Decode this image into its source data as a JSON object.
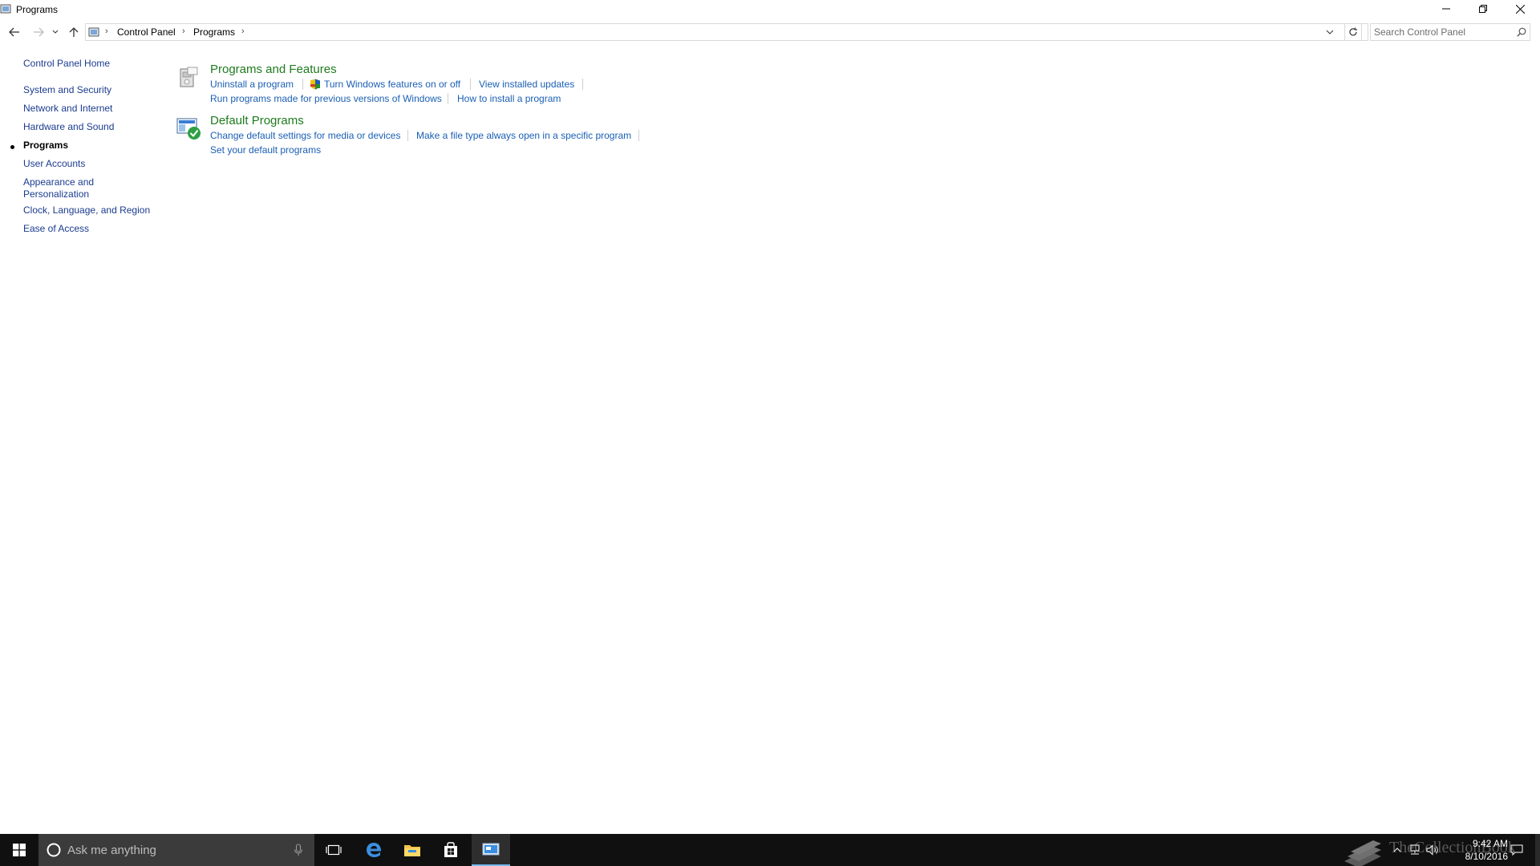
{
  "window": {
    "title": "Programs"
  },
  "address": {
    "crumbs": [
      "Control Panel",
      "Programs"
    ],
    "search_placeholder": "Search Control Panel"
  },
  "leftnav": {
    "home": "Control Panel Home",
    "items": [
      {
        "label": "System and Security",
        "current": false
      },
      {
        "label": "Network and Internet",
        "current": false
      },
      {
        "label": "Hardware and Sound",
        "current": false
      },
      {
        "label": "Programs",
        "current": true
      },
      {
        "label": "User Accounts",
        "current": false
      },
      {
        "label": "Appearance and",
        "label2": "Personalization",
        "current": false
      },
      {
        "label": "Clock, Language, and Region",
        "current": false
      },
      {
        "label": "Ease of Access",
        "current": false
      }
    ]
  },
  "sections": [
    {
      "title": "Programs and Features",
      "icon": "programs-features-icon",
      "links": [
        "Uninstall a program",
        "Turn Windows features on or off",
        "View installed updates",
        "Run programs made for previous versions of Windows",
        "How to install a program"
      ]
    },
    {
      "title": "Default Programs",
      "icon": "default-programs-icon",
      "links": [
        "Change default settings for media or devices",
        "Make a file type always open in a specific program",
        "Set your default programs"
      ]
    }
  ],
  "taskbar": {
    "search_text": "Ask me anything",
    "time": "9:42 AM",
    "date": "8/10/2016",
    "watermark": "TheCollectionBook"
  },
  "colors": {
    "link": "#1a5fb4",
    "section_title": "#1e7b1e",
    "taskbar": "#101010",
    "taskbar_search": "#3b3b3b"
  }
}
